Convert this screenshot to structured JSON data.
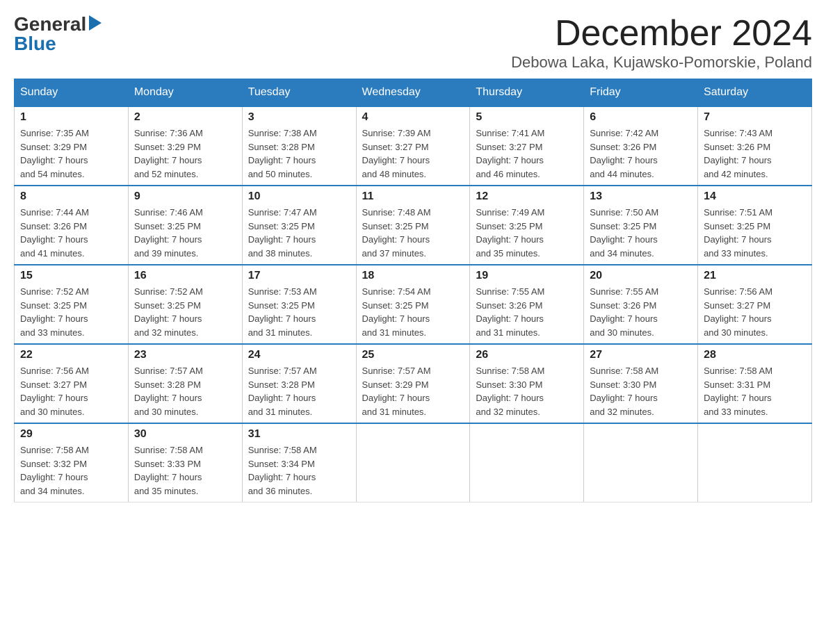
{
  "logo": {
    "general": "General",
    "triangle": "▶",
    "blue": "Blue"
  },
  "title": {
    "month": "December 2024",
    "location": "Debowa Laka, Kujawsko-Pomorskie, Poland"
  },
  "header": {
    "days": [
      "Sunday",
      "Monday",
      "Tuesday",
      "Wednesday",
      "Thursday",
      "Friday",
      "Saturday"
    ]
  },
  "weeks": [
    [
      {
        "num": "1",
        "info": "Sunrise: 7:35 AM\nSunset: 3:29 PM\nDaylight: 7 hours\nand 54 minutes."
      },
      {
        "num": "2",
        "info": "Sunrise: 7:36 AM\nSunset: 3:29 PM\nDaylight: 7 hours\nand 52 minutes."
      },
      {
        "num": "3",
        "info": "Sunrise: 7:38 AM\nSunset: 3:28 PM\nDaylight: 7 hours\nand 50 minutes."
      },
      {
        "num": "4",
        "info": "Sunrise: 7:39 AM\nSunset: 3:27 PM\nDaylight: 7 hours\nand 48 minutes."
      },
      {
        "num": "5",
        "info": "Sunrise: 7:41 AM\nSunset: 3:27 PM\nDaylight: 7 hours\nand 46 minutes."
      },
      {
        "num": "6",
        "info": "Sunrise: 7:42 AM\nSunset: 3:26 PM\nDaylight: 7 hours\nand 44 minutes."
      },
      {
        "num": "7",
        "info": "Sunrise: 7:43 AM\nSunset: 3:26 PM\nDaylight: 7 hours\nand 42 minutes."
      }
    ],
    [
      {
        "num": "8",
        "info": "Sunrise: 7:44 AM\nSunset: 3:26 PM\nDaylight: 7 hours\nand 41 minutes."
      },
      {
        "num": "9",
        "info": "Sunrise: 7:46 AM\nSunset: 3:25 PM\nDaylight: 7 hours\nand 39 minutes."
      },
      {
        "num": "10",
        "info": "Sunrise: 7:47 AM\nSunset: 3:25 PM\nDaylight: 7 hours\nand 38 minutes."
      },
      {
        "num": "11",
        "info": "Sunrise: 7:48 AM\nSunset: 3:25 PM\nDaylight: 7 hours\nand 37 minutes."
      },
      {
        "num": "12",
        "info": "Sunrise: 7:49 AM\nSunset: 3:25 PM\nDaylight: 7 hours\nand 35 minutes."
      },
      {
        "num": "13",
        "info": "Sunrise: 7:50 AM\nSunset: 3:25 PM\nDaylight: 7 hours\nand 34 minutes."
      },
      {
        "num": "14",
        "info": "Sunrise: 7:51 AM\nSunset: 3:25 PM\nDaylight: 7 hours\nand 33 minutes."
      }
    ],
    [
      {
        "num": "15",
        "info": "Sunrise: 7:52 AM\nSunset: 3:25 PM\nDaylight: 7 hours\nand 33 minutes."
      },
      {
        "num": "16",
        "info": "Sunrise: 7:52 AM\nSunset: 3:25 PM\nDaylight: 7 hours\nand 32 minutes."
      },
      {
        "num": "17",
        "info": "Sunrise: 7:53 AM\nSunset: 3:25 PM\nDaylight: 7 hours\nand 31 minutes."
      },
      {
        "num": "18",
        "info": "Sunrise: 7:54 AM\nSunset: 3:25 PM\nDaylight: 7 hours\nand 31 minutes."
      },
      {
        "num": "19",
        "info": "Sunrise: 7:55 AM\nSunset: 3:26 PM\nDaylight: 7 hours\nand 31 minutes."
      },
      {
        "num": "20",
        "info": "Sunrise: 7:55 AM\nSunset: 3:26 PM\nDaylight: 7 hours\nand 30 minutes."
      },
      {
        "num": "21",
        "info": "Sunrise: 7:56 AM\nSunset: 3:27 PM\nDaylight: 7 hours\nand 30 minutes."
      }
    ],
    [
      {
        "num": "22",
        "info": "Sunrise: 7:56 AM\nSunset: 3:27 PM\nDaylight: 7 hours\nand 30 minutes."
      },
      {
        "num": "23",
        "info": "Sunrise: 7:57 AM\nSunset: 3:28 PM\nDaylight: 7 hours\nand 30 minutes."
      },
      {
        "num": "24",
        "info": "Sunrise: 7:57 AM\nSunset: 3:28 PM\nDaylight: 7 hours\nand 31 minutes."
      },
      {
        "num": "25",
        "info": "Sunrise: 7:57 AM\nSunset: 3:29 PM\nDaylight: 7 hours\nand 31 minutes."
      },
      {
        "num": "26",
        "info": "Sunrise: 7:58 AM\nSunset: 3:30 PM\nDaylight: 7 hours\nand 32 minutes."
      },
      {
        "num": "27",
        "info": "Sunrise: 7:58 AM\nSunset: 3:30 PM\nDaylight: 7 hours\nand 32 minutes."
      },
      {
        "num": "28",
        "info": "Sunrise: 7:58 AM\nSunset: 3:31 PM\nDaylight: 7 hours\nand 33 minutes."
      }
    ],
    [
      {
        "num": "29",
        "info": "Sunrise: 7:58 AM\nSunset: 3:32 PM\nDaylight: 7 hours\nand 34 minutes."
      },
      {
        "num": "30",
        "info": "Sunrise: 7:58 AM\nSunset: 3:33 PM\nDaylight: 7 hours\nand 35 minutes."
      },
      {
        "num": "31",
        "info": "Sunrise: 7:58 AM\nSunset: 3:34 PM\nDaylight: 7 hours\nand 36 minutes."
      },
      null,
      null,
      null,
      null
    ]
  ]
}
